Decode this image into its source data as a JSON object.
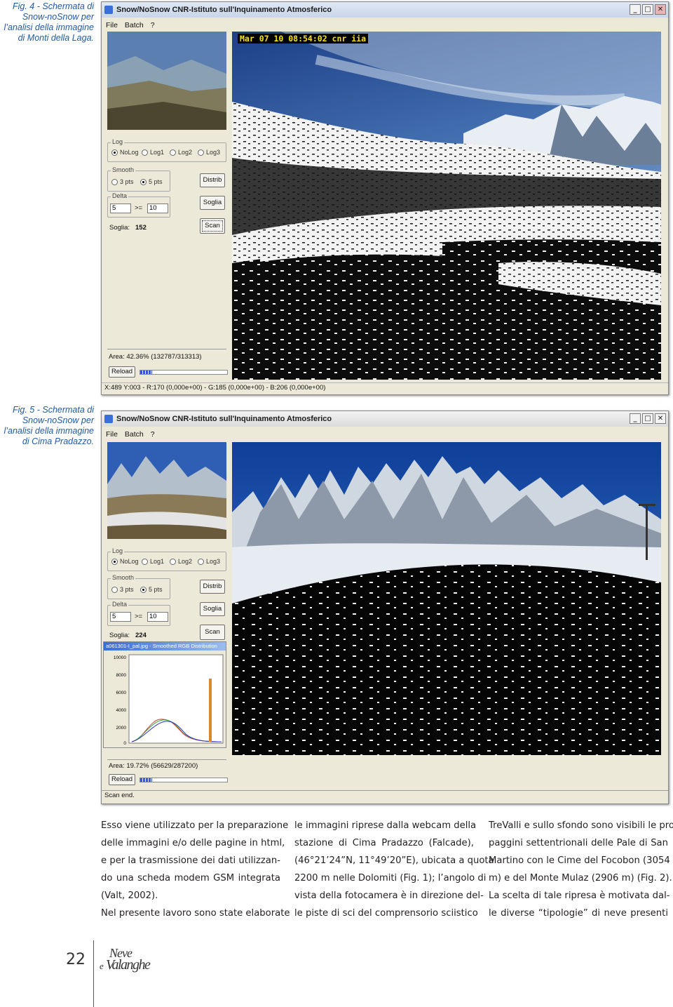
{
  "captions": {
    "fig4": [
      "Fig. 4 - Schermata di",
      "Snow-noSnow per",
      "l’analisi della immagine",
      "di Monti della Laga."
    ],
    "fig5": [
      "Fig. 5 - Schermata di",
      "Snow-noSnow per",
      "l’analisi della immagine",
      "di Cima Pradazzo."
    ]
  },
  "window1": {
    "title": "Snow/NoSnow CNR-Istituto sull'Inquinamento Atmosferico",
    "menu": [
      "File",
      "Batch",
      "?"
    ],
    "timestamp": "Mar 07 10 08:54:02 cnr iia",
    "log_label": "Log",
    "log_options": [
      "NoLog",
      "Log1",
      "Log2",
      "Log3"
    ],
    "smooth_label": "Smooth",
    "smooth_options": [
      "3 pts",
      "5 pts"
    ],
    "delta_label": "Delta",
    "delta_value": "5",
    "ge_symbol": ">=",
    "ge_value": "10",
    "soglia_label": "Soglia:",
    "soglia_value": "152",
    "buttons": {
      "distrib": "Distrib",
      "soglia": "Soglia",
      "scan": "Scan",
      "reload": "Reload"
    },
    "area_text": "Area: 42.36% (132787/313313)",
    "status_text": "X:489 Y:003 - R:170 (0,000e+00) - G:185 (0,000e+00) - B:206 (0,000e+00)"
  },
  "window2": {
    "title": "Snow/NoSnow CNR-Istituto sull'Inquinamento Atmosferico",
    "menu": [
      "File",
      "Batch",
      "?"
    ],
    "log_label": "Log",
    "log_options": [
      "NoLog",
      "Log1",
      "Log2",
      "Log3"
    ],
    "smooth_label": "Smooth",
    "smooth_options": [
      "3 pts",
      "5 pts"
    ],
    "delta_label": "Delta",
    "delta_value": "5",
    "ge_symbol": ">=",
    "ge_value": "10",
    "soglia_label": "Soglia:",
    "soglia_value": "224",
    "buttons": {
      "distrib": "Distrib",
      "soglia": "Soglia",
      "scan": "Scan",
      "reload": "Reload"
    },
    "chart_window_title": "a061301-I_pal.jpg - Smoothed RGB Distribution",
    "chart_ticks": [
      "10000",
      "8000",
      "6000",
      "4000",
      "2000",
      "0"
    ],
    "area_text": "Area: 19.72% (56629/287200)",
    "status_text": "Scan end."
  },
  "columns": [
    [
      "Esso viene utilizzato per la preparazione",
      "delle immagini e/o delle pagine in html,",
      "e per la trasmissione dei dati utilizzan-",
      "do una scheda modem GSM integrata",
      "(Valt, 2002).",
      "Nel presente lavoro sono state elaborate"
    ],
    [
      "le immagini riprese dalla webcam della",
      "stazione di Cima Pradazzo (Falcade),",
      "(46°21’24”N, 11°49’20”E), ubicata a quota",
      "2200 m nelle Dolomiti (Fig. 1); l’angolo di",
      "vista della fotocamera è in direzione del-",
      "le piste di sci del comprensorio sciistico"
    ],
    [
      "TreValli e sullo sfondo sono visibili le pro-",
      "paggini settentrionali delle Pale di San",
      "Martino con le Cime del Focobon (3054",
      "m) e del Monte Mulaz (2906 m) (Fig. 2).",
      "La scelta di tale ripresa è motivata dal-",
      "le diverse “tipologie” di neve presenti"
    ]
  ],
  "page_number": "22",
  "masthead": {
    "neve": "Neve",
    "e": "e",
    "valanghe": "Valanghe"
  },
  "colors": {
    "caption": "#1f5aa8",
    "timestamp": "#f7e400",
    "progress": "#3a57c9"
  }
}
